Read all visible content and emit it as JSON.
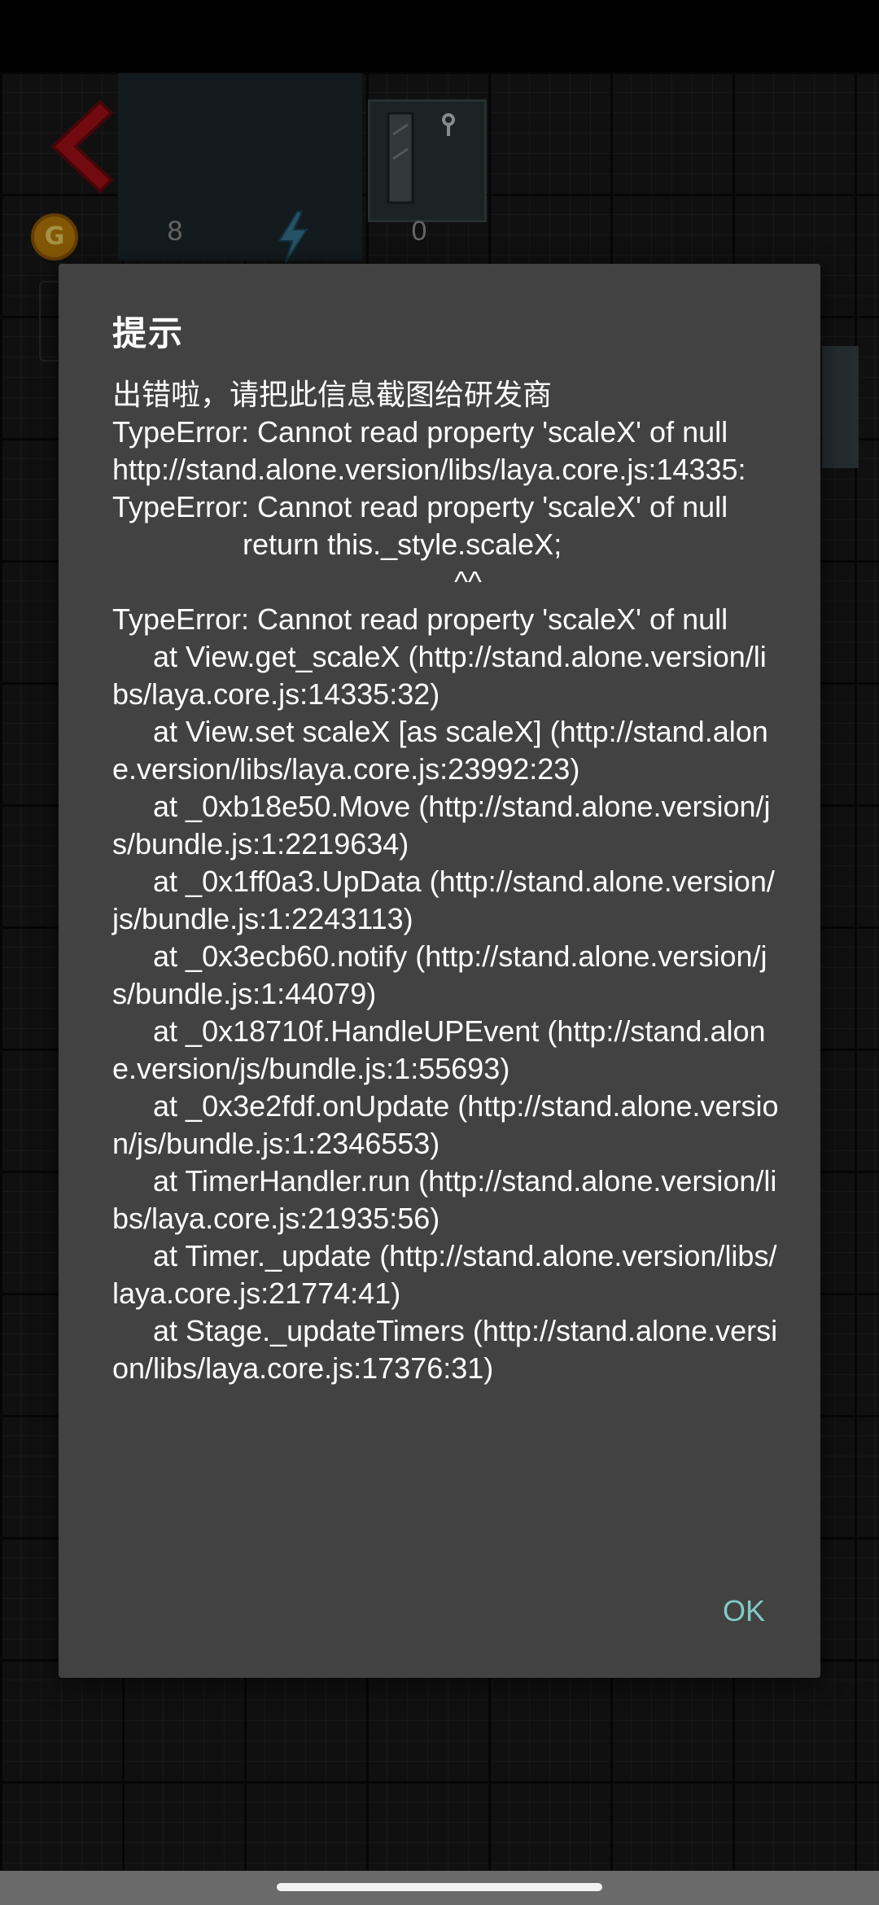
{
  "game": {
    "coin_count": "8",
    "energy_count": "0",
    "coin_symbol": "G"
  },
  "dialog": {
    "title": "提示",
    "message": "出错啦，请把此信息截图给研发商\nTypeError: Cannot read property 'scaleX' of null\nhttp://stand.alone.version/libs/laya.core.js:14335:\nTypeError: Cannot read property 'scaleX' of null\n                return this._style.scaleX;\n                                          ^^\nTypeError: Cannot read property 'scaleX' of null\n     at View.get_scaleX (http://stand.alone.version/libs/laya.core.js:14335:32)\n     at View.set scaleX [as scaleX] (http://stand.alone.version/libs/laya.core.js:23992:23)\n     at _0xb18e50.Move (http://stand.alone.version/js/bundle.js:1:2219634)\n     at _0x1ff0a3.UpData (http://stand.alone.version/js/bundle.js:1:2243113)\n     at _0x3ecb60.notify (http://stand.alone.version/js/bundle.js:1:44079)\n     at _0x18710f.HandleUPEvent (http://stand.alone.version/js/bundle.js:1:55693)\n     at _0x3e2fdf.onUpdate (http://stand.alone.version/js/bundle.js:1:2346553)\n     at TimerHandler.run (http://stand.alone.version/libs/laya.core.js:21935:56)\n     at Timer._update (http://stand.alone.version/libs/laya.core.js:21774:41)\n     at Stage._updateTimers (http://stand.alone.version/libs/laya.core.js:17376:31)",
    "ok_label": "OK"
  },
  "colors": {
    "dialog_bg": "#424242",
    "ok_accent": "#80cbc4",
    "back_arrow": "#b0121a"
  },
  "icons": {
    "back": "back-arrow-icon",
    "coin": "coin-icon",
    "energy": "lightning-bolt-icon",
    "item": "door-lock-icon"
  }
}
